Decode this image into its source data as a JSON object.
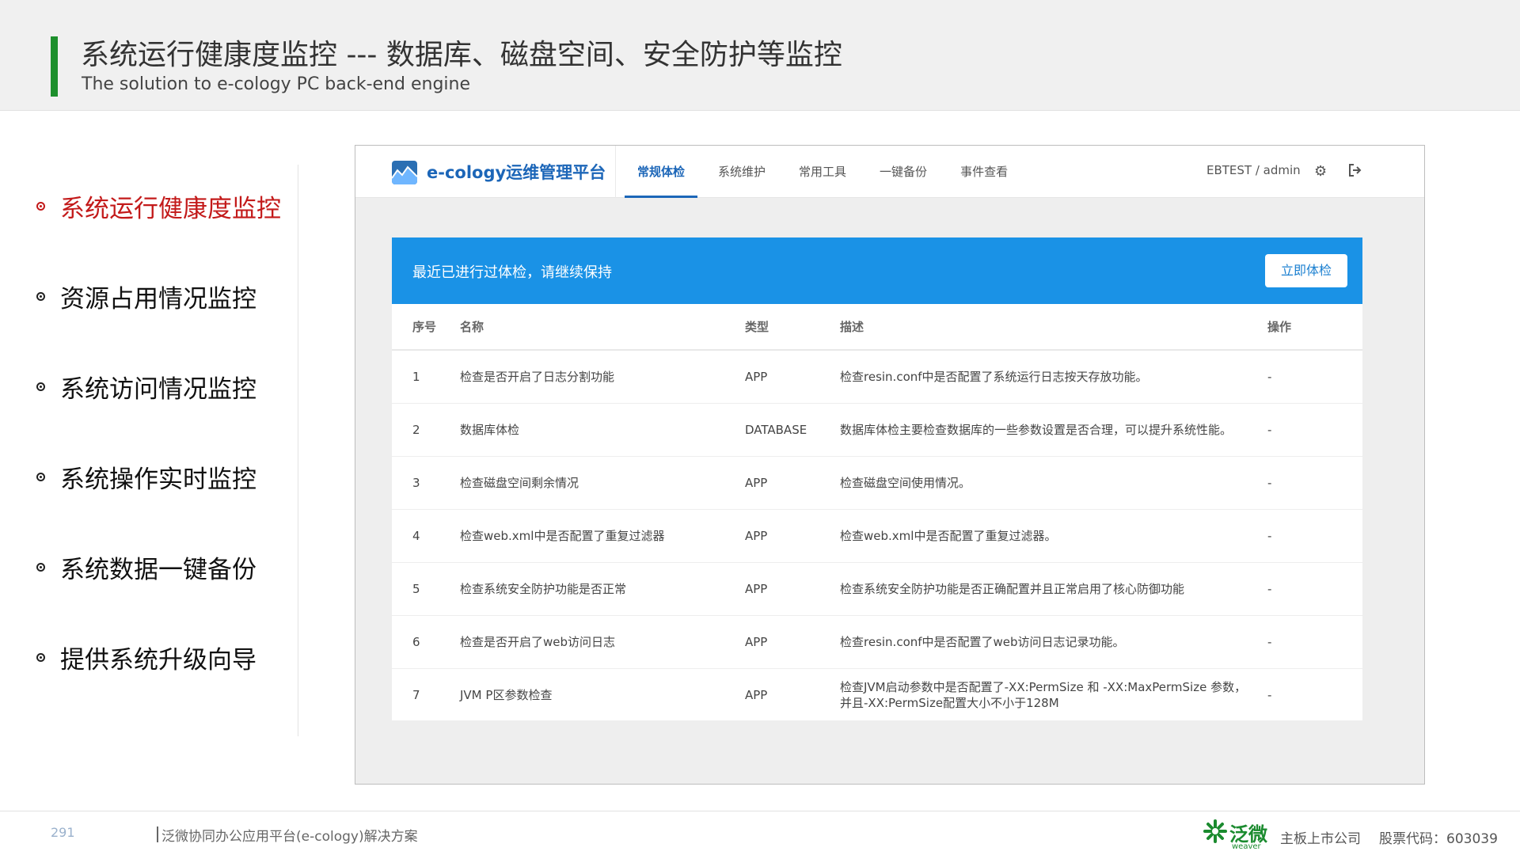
{
  "slide": {
    "title": "系统运行健康度监控 --- 数据库、磁盘空间、安全防护等监控",
    "subtitle": "The solution to e-cology PC back-end engine",
    "accent_color": "#1d8f2c"
  },
  "bullets": [
    {
      "label": "系统运行健康度监控",
      "active": true
    },
    {
      "label": "资源占用情况监控",
      "active": false
    },
    {
      "label": "系统访问情况监控",
      "active": false
    },
    {
      "label": "系统操作实时监控",
      "active": false
    },
    {
      "label": "系统数据一键备份",
      "active": false
    },
    {
      "label": "提供系统升级向导",
      "active": false
    }
  ],
  "app": {
    "brand": "e-cology运维管理平台",
    "brand_color": "#1c66b8",
    "nav": [
      "常规体检",
      "系统维护",
      "常用工具",
      "一键备份",
      "事件查看"
    ],
    "active_nav": "常规体检",
    "user": "EBTEST / admin",
    "icons": [
      "gear-icon",
      "logout-icon"
    ],
    "banner": {
      "text": "最近已进行过体检，请继续保持",
      "button": "立即体检",
      "color": "#1a92e6"
    },
    "table": {
      "headers": [
        "序号",
        "名称",
        "类型",
        "描述",
        "操作"
      ],
      "rows": [
        {
          "no": "1",
          "name": "检查是否开启了日志分割功能",
          "type": "APP",
          "desc": "检查resin.conf中是否配置了系统运行日志按天存放功能。",
          "op": "-"
        },
        {
          "no": "2",
          "name": "数据库体检",
          "type": "DATABASE",
          "desc": "数据库体检主要检查数据库的一些参数设置是否合理，可以提升系统性能。",
          "op": "-"
        },
        {
          "no": "3",
          "name": "检查磁盘空间剩余情况",
          "type": "APP",
          "desc": "检查磁盘空间使用情况。",
          "op": "-"
        },
        {
          "no": "4",
          "name": "检查web.xml中是否配置了重复过滤器",
          "type": "APP",
          "desc": "检查web.xml中是否配置了重复过滤器。",
          "op": "-"
        },
        {
          "no": "5",
          "name": "检查系统安全防护功能是否正常",
          "type": "APP",
          "desc": "检查系统安全防护功能是否正确配置并且正常启用了核心防御功能",
          "op": "-"
        },
        {
          "no": "6",
          "name": "检查是否开启了web访问日志",
          "type": "APP",
          "desc": "检查resin.conf中是否配置了web访问日志记录功能。",
          "op": "-"
        },
        {
          "no": "7",
          "name": "JVM P区参数检查",
          "type": "APP",
          "desc": "检查JVM启动参数中是否配置了-XX:PermSize 和 -XX:MaxPermSize 参数，并且-XX:PermSize配置大小不小于128M",
          "op": "-"
        }
      ]
    }
  },
  "footer": {
    "page": "291",
    "text": "泛微协同办公应用平台(e-cology)解决方案",
    "logo_text": "泛微",
    "logo_sub": "weaver",
    "listed": "主板上市公司",
    "stock": "股票代码：603039"
  }
}
